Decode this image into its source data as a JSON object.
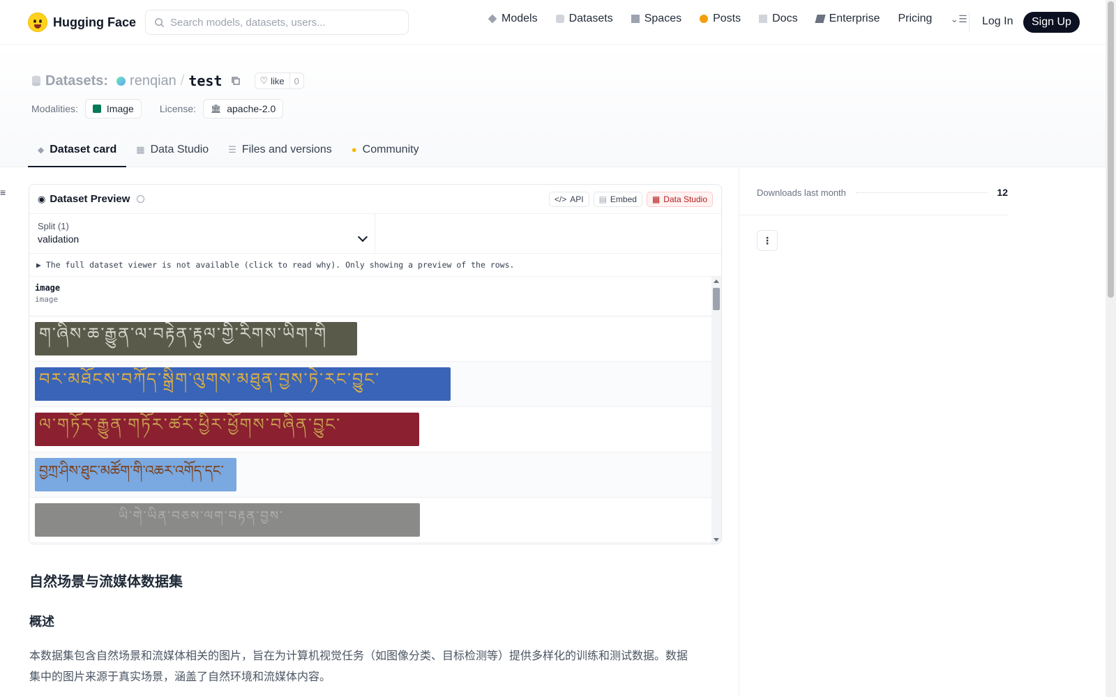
{
  "nav": {
    "brand": "Hugging Face",
    "search_placeholder": "Search models, datasets, users...",
    "links": [
      "Models",
      "Datasets",
      "Spaces",
      "Posts",
      "Docs",
      "Enterprise",
      "Pricing"
    ],
    "login": "Log In",
    "signup": "Sign Up"
  },
  "header": {
    "kind": "Datasets:",
    "user": "renqian",
    "slash": "/",
    "name": "test",
    "like_label": "like",
    "like_count": "0",
    "modalities_label": "Modalities:",
    "modality": "Image",
    "license_label": "License:",
    "license": "apache-2.0"
  },
  "tabs": [
    "Dataset card",
    "Data Studio",
    "Files and versions",
    "Community"
  ],
  "preview": {
    "title": "Dataset Preview",
    "api": "API",
    "embed": "Embed",
    "studio": "Data Studio",
    "split_label": "Split (1)",
    "split_value": "validation",
    "notice": "▶ The full dataset viewer is not available (click to read why). Only showing a preview of the rows.",
    "column_name": "image",
    "column_type": "image",
    "rows": [
      {
        "text": "ག་ཞིས་ཆ་རྒྱུན་ལ་བརྟེན་རྟུལ་གྱི་རིགས་ཡིག་གི",
        "bg": "#5a5a4a",
        "fg": "#d8d8d0"
      },
      {
        "text": "བར་མཐོངས་བཀོད་སྒྲིག་ལུགས་མཐུན་བྱས་ཏེ་རང་བྱུང་",
        "bg": "#3a64b8",
        "fg": "#e0b040"
      },
      {
        "text": "ལ་གཏོར་རྒྱུན་གཏོར་ཚར་ཕྱིར་ཕྱོགས་བཞིན་བྱུང་",
        "bg": "#8a2030",
        "fg": "#c8a050"
      },
      {
        "text": "བྱཀྲ་ཤིས་ཐུང་མཚོག་གི་འཆར་འགོད་དང་",
        "bg": "#7aa8e0",
        "fg": "#7a3a10"
      },
      {
        "text": "ཡི་གེ་ཡིན་བཅས་ལག་བརྟན་བྱས་",
        "bg": "#8a8a88",
        "fg": "#b0b0ae"
      }
    ]
  },
  "content": {
    "h2": "自然场景与流媒体数据集",
    "h3": "概述",
    "para": "本数据集包含自然场景和流媒体相关的图片，旨在为计算机视觉任务（如图像分类、目标检测等）提供多样化的训练和测试数据。数据集中的图片来源于真实场景，涵盖了自然环境和流媒体内容。"
  },
  "sidebar": {
    "downloads_label": "Downloads last month",
    "downloads_value": "12"
  }
}
